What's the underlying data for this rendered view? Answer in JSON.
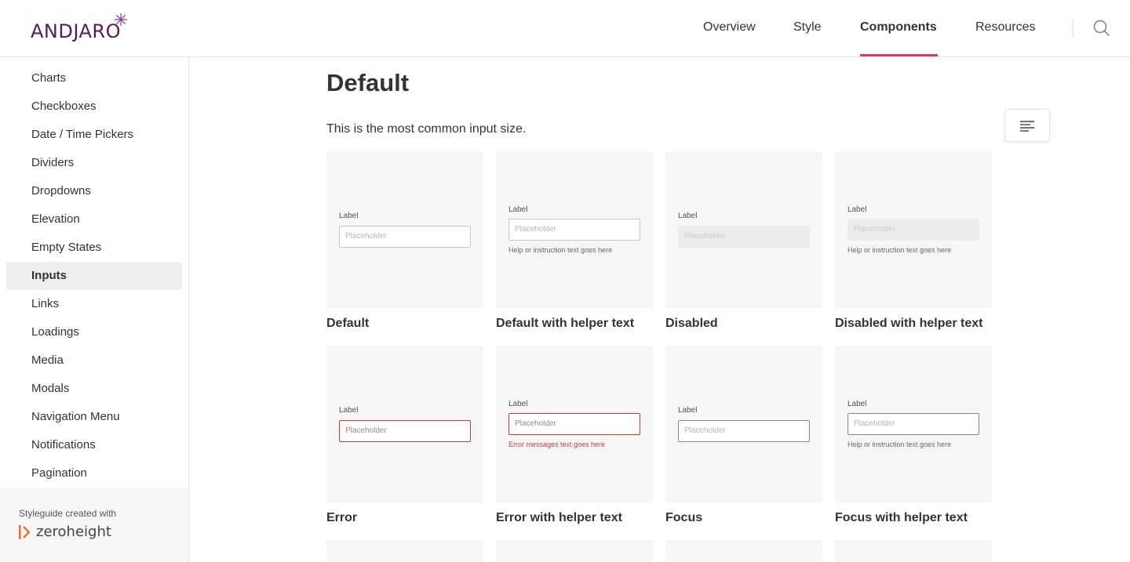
{
  "brand": {
    "name": "ANDJARO"
  },
  "nav": {
    "items": [
      {
        "label": "Overview",
        "active": false
      },
      {
        "label": "Style",
        "active": false
      },
      {
        "label": "Components",
        "active": true
      },
      {
        "label": "Resources",
        "active": false
      }
    ]
  },
  "sidebar": {
    "items": [
      {
        "label": "Charts",
        "active": false
      },
      {
        "label": "Checkboxes",
        "active": false
      },
      {
        "label": "Date / Time Pickers",
        "active": false
      },
      {
        "label": "Dividers",
        "active": false
      },
      {
        "label": "Dropdowns",
        "active": false
      },
      {
        "label": "Elevation",
        "active": false
      },
      {
        "label": "Empty States",
        "active": false
      },
      {
        "label": "Inputs",
        "active": true
      },
      {
        "label": "Links",
        "active": false
      },
      {
        "label": "Loadings",
        "active": false
      },
      {
        "label": "Media",
        "active": false
      },
      {
        "label": "Modals",
        "active": false
      },
      {
        "label": "Navigation Menu",
        "active": false
      },
      {
        "label": "Notifications",
        "active": false
      },
      {
        "label": "Pagination",
        "active": false
      }
    ],
    "footer": {
      "made_with": "Styleguide created with",
      "brand": "zeroheight"
    }
  },
  "main": {
    "title": "Default",
    "intro": "This is the most common input size.",
    "cards": [
      {
        "caption": "Default",
        "label": "Label",
        "placeholder": "Placeholder",
        "helper": "",
        "state": "default"
      },
      {
        "caption": "Default with helper text",
        "label": "Label",
        "placeholder": "Placeholder",
        "helper": "Help or instruction text goes here",
        "state": "default"
      },
      {
        "caption": "Disabled",
        "label": "Label",
        "placeholder": "Placeholder",
        "helper": "",
        "state": "disabled"
      },
      {
        "caption": "Disabled with helper text",
        "label": "Label",
        "placeholder": "Placeholder",
        "helper": "Help or instruction text goes here",
        "state": "disabled"
      },
      {
        "caption": "Error",
        "label": "Label",
        "placeholder": "Placeholder",
        "helper": "",
        "state": "error"
      },
      {
        "caption": "Error with helper text",
        "label": "Label",
        "placeholder": "Placeholder",
        "helper": "Error messages text goes here",
        "state": "error"
      },
      {
        "caption": "Focus",
        "label": "Label",
        "placeholder": "Placeholder",
        "helper": "",
        "state": "focus"
      },
      {
        "caption": "Focus with helper text",
        "label": "Label",
        "placeholder": "Placeholder",
        "helper": "Help or instruction text goes here",
        "state": "focus"
      }
    ]
  },
  "colors": {
    "brand": "#5c1a4f",
    "accent": "#e8336c",
    "error": "#c43b3b"
  },
  "icons": {
    "search": "search-icon",
    "toc": "table-of-contents-icon",
    "zeroheight": "zeroheight-logo-icon"
  }
}
